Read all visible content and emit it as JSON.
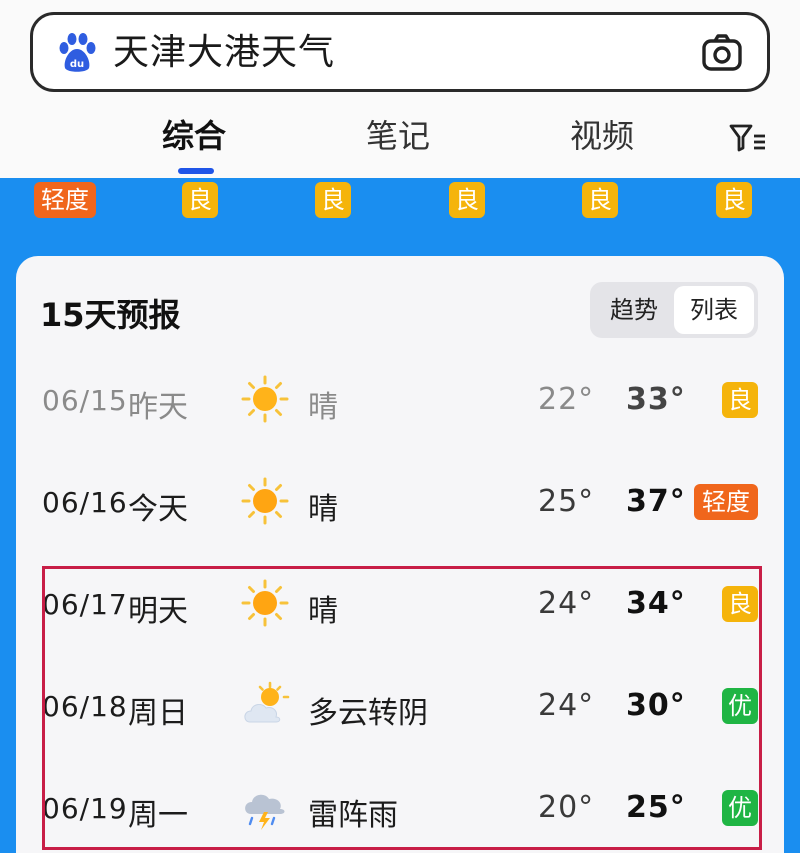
{
  "search": {
    "query": "天津大港天气"
  },
  "tabs": [
    {
      "label": "综合"
    },
    {
      "label": "笔记"
    },
    {
      "label": "视频"
    }
  ],
  "aqi_strip": [
    "轻度",
    "良",
    "良",
    "良",
    "良",
    "良"
  ],
  "forecast": {
    "title": "15天预报",
    "toggle": {
      "trend": "趋势",
      "list": "列表"
    },
    "rows": [
      {
        "date": "06/15",
        "day": "昨天",
        "icon": "sun-icon",
        "cond": "晴",
        "low": "22°",
        "high": "33°",
        "aqi": "良"
      },
      {
        "date": "06/16",
        "day": "今天",
        "icon": "sun-icon",
        "cond": "晴",
        "low": "25°",
        "high": "37°",
        "aqi": "轻度"
      },
      {
        "date": "06/17",
        "day": "明天",
        "icon": "sun-icon",
        "cond": "晴",
        "low": "24°",
        "high": "34°",
        "aqi": "良"
      },
      {
        "date": "06/18",
        "day": "周日",
        "icon": "partly-cloudy-icon",
        "cond": "多云转阴",
        "low": "24°",
        "high": "30°",
        "aqi": "优"
      },
      {
        "date": "06/19",
        "day": "周一",
        "icon": "thunderstorm-icon",
        "cond": "雷阵雨",
        "low": "20°",
        "high": "25°",
        "aqi": "优"
      }
    ]
  },
  "colors": {
    "accent_blue": "#1f55e8",
    "band_blue": "#1a8ef0",
    "aqi_good": "#f5b40b",
    "aqi_light": "#f0661c",
    "aqi_excellent": "#1fb544",
    "highlight_border": "#c81e47"
  }
}
